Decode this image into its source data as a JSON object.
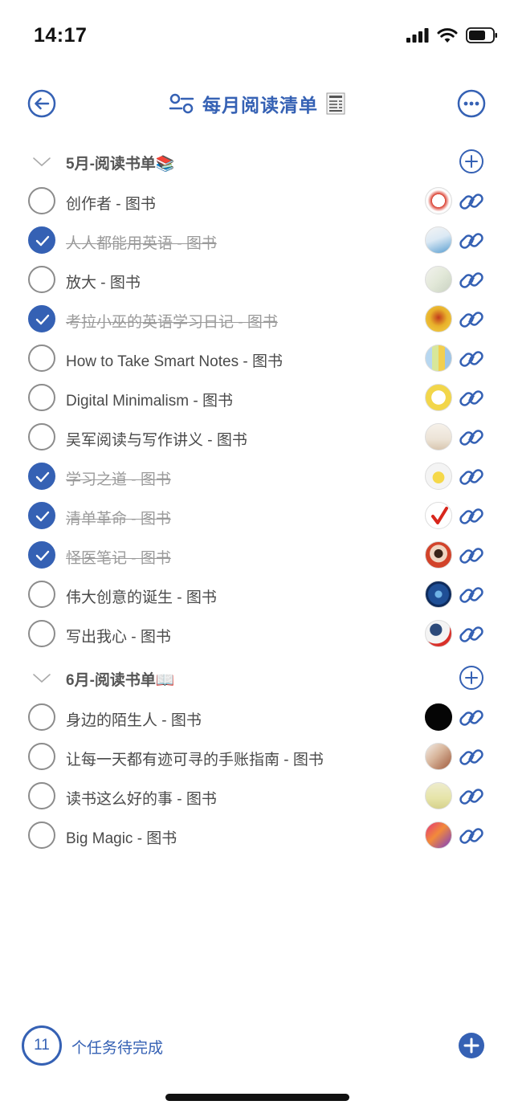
{
  "status": {
    "time": "14:17"
  },
  "nav": {
    "title": "每月阅读清单"
  },
  "sections": [
    {
      "title": "5月-阅读书单📚"
    },
    {
      "title": "6月-阅读书单📖"
    }
  ],
  "tasks": [
    {
      "title": "创作者 - 图书",
      "done": false
    },
    {
      "title": "人人都能用英语 - 图书",
      "done": true
    },
    {
      "title": "放大 - 图书",
      "done": false
    },
    {
      "title": "考拉小巫的英语学习日记 - 图书",
      "done": true
    },
    {
      "title": "How to Take Smart Notes - 图书",
      "done": false
    },
    {
      "title": "Digital Minimalism - 图书",
      "done": false
    },
    {
      "title": "吴军阅读与写作讲义 - 图书",
      "done": false
    },
    {
      "title": "学习之道 - 图书",
      "done": true
    },
    {
      "title": "清单革命 - 图书",
      "done": true
    },
    {
      "title": "怪医笔记 - 图书",
      "done": true
    },
    {
      "title": "伟大创意的诞生 - 图书",
      "done": false
    },
    {
      "title": "写出我心 - 图书",
      "done": false
    },
    {
      "title": "身边的陌生人 - 图书",
      "done": false
    },
    {
      "title": "让每一天都有迹可寻的手账指南 - 图书",
      "done": false
    },
    {
      "title": "读书这么好的事 - 图书",
      "done": false
    },
    {
      "title": "Big Magic - 图书",
      "done": false
    }
  ],
  "footer": {
    "count": "11",
    "label": "个任务待完成"
  },
  "colors": {
    "accent": "#3561b4",
    "text": "#4a4a4a",
    "done_text": "#9a9a9a"
  }
}
